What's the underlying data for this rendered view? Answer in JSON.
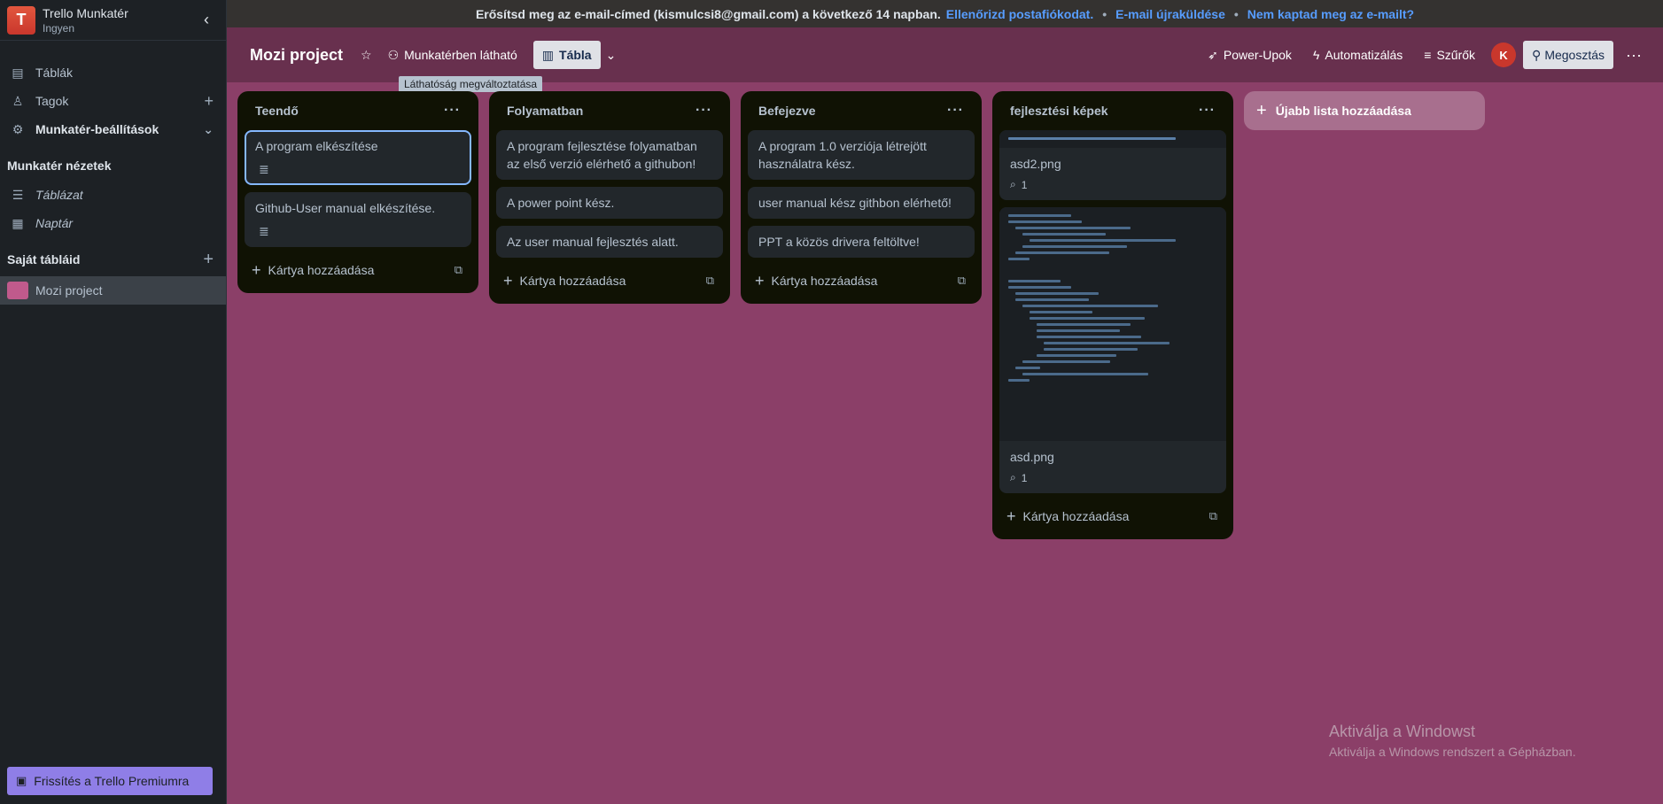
{
  "banner": {
    "text": "Erősítsd meg az e-mail-címed (kismulcsi8@gmail.com) a következő 14 napban.",
    "link1": "Ellenőrizd postafiókodat.",
    "link2": "E-mail újraküldése",
    "link3": "Nem kaptad meg az e-mailt?"
  },
  "workspace": {
    "initial": "T",
    "name": "Trello Munkatér",
    "plan": "Ingyen"
  },
  "sidebar": {
    "items": [
      {
        "label": "Táblák",
        "icon": "board-icon"
      },
      {
        "label": "Tagok",
        "icon": "person-icon"
      },
      {
        "label": "Munkatér-beállítások",
        "icon": "gear-icon"
      }
    ],
    "views_title": "Munkatér nézetek",
    "views": [
      {
        "label": "Táblázat",
        "icon": "table-icon"
      },
      {
        "label": "Naptár",
        "icon": "calendar-icon"
      }
    ],
    "boards_title": "Saját tábláid",
    "boards": [
      {
        "label": "Mozi project",
        "color": "#c05a8c"
      }
    ],
    "upgrade": "Frissítés a Trello Premiumra"
  },
  "header": {
    "title": "Mozi project",
    "visibility": "Munkatérben látható",
    "view": "Tábla",
    "powerups": "Power-Upok",
    "automation": "Automatizálás",
    "filters": "Szűrők",
    "avatar": "K",
    "share": "Megosztás",
    "tooltip": "Láthatóság megváltoztatása"
  },
  "lists": [
    {
      "title": "Teendő",
      "cards": [
        {
          "text": "A program elkészítése",
          "has_desc": true
        },
        {
          "text": "Github-User manual elkészítése.",
          "has_desc": true
        }
      ],
      "add": "Kártya hozzáadása"
    },
    {
      "title": "Folyamatban",
      "cards": [
        {
          "text": "A program fejlesztése folyamatban az első verzió elérhető a githubon!"
        },
        {
          "text": "A power point kész."
        },
        {
          "text": "Az user manual fejlesztés alatt."
        }
      ],
      "add": "Kártya hozzáadása"
    },
    {
      "title": "Befejezve",
      "cards": [
        {
          "text": "A program 1.0 verziója létrejött használatra kész."
        },
        {
          "text": "user manual kész githbon elérhető!"
        },
        {
          "text": "PPT a közös drivera feltöltve!"
        }
      ],
      "add": "Kártya hozzáadása"
    },
    {
      "title": "fejlesztési képek",
      "cards": [
        {
          "text": "asd2.png",
          "attachments": "1"
        },
        {
          "text": "asd.png",
          "attachments": "1"
        }
      ],
      "add": "Kártya hozzáadása"
    }
  ],
  "add_list": "Újabb lista hozzáadása",
  "watermark": {
    "title": "Aktiválja a Windowst",
    "subtitle": "Aktiválja a Windows rendszert a Gépházban."
  }
}
